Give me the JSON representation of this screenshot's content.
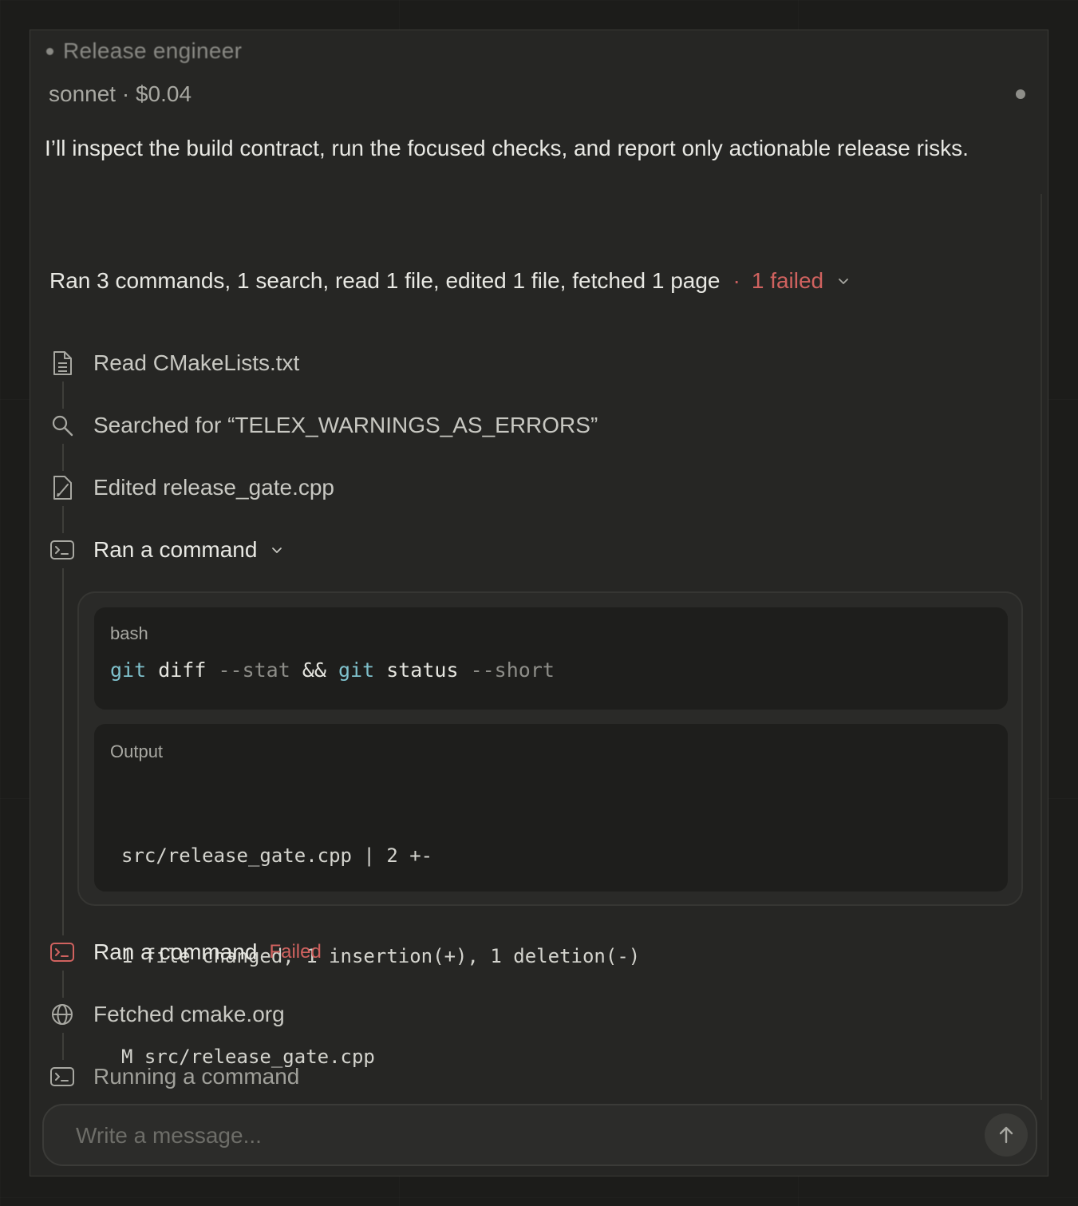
{
  "agent": {
    "name": "Release engineer",
    "meta": "sonnet · $0.04"
  },
  "message": {
    "text": "I’ll inspect the build contract, run the focused checks, and report only actionable release risks."
  },
  "summary": {
    "text": "Ran 3 commands, 1 search, read 1 file, edited 1 file, fetched 1 page",
    "separator": "·",
    "failed": "1 failed"
  },
  "steps": [
    {
      "icon": "file-icon",
      "label": "Read CMakeLists.txt"
    },
    {
      "icon": "search-icon",
      "label": "Searched for “TELEX_WARNINGS_AS_ERRORS”"
    },
    {
      "icon": "edit-file-icon",
      "label": "Edited release_gate.cpp"
    },
    {
      "icon": "terminal-icon",
      "label": "Ran a command",
      "expanded": true
    },
    {
      "icon": "terminal-icon",
      "label": "Ran a command",
      "status": "Failed"
    },
    {
      "icon": "globe-icon",
      "label": "Fetched cmake.org"
    },
    {
      "icon": "terminal-icon",
      "label": "Running a command"
    }
  ],
  "command": {
    "language": "bash",
    "tokens": [
      {
        "t": "git",
        "k": "cmd"
      },
      {
        "t": " diff ",
        "k": "plain"
      },
      {
        "t": "--stat",
        "k": "flag"
      },
      {
        "t": " && ",
        "k": "plain"
      },
      {
        "t": "git",
        "k": "cmd"
      },
      {
        "t": " status ",
        "k": "plain"
      },
      {
        "t": "--short",
        "k": "flag"
      }
    ],
    "output_label": "Output",
    "output_lines": [
      "src/release_gate.cpp | 2 +-",
      "1 file changed, 1 insertion(+), 1 deletion(-)",
      "M src/release_gate.cpp"
    ]
  },
  "composer": {
    "placeholder": "Write a message..."
  },
  "colors": {
    "background": "#262624",
    "text": "#e8e8e3",
    "failed": "#d0625f",
    "command_token": "#7fc1cc"
  }
}
